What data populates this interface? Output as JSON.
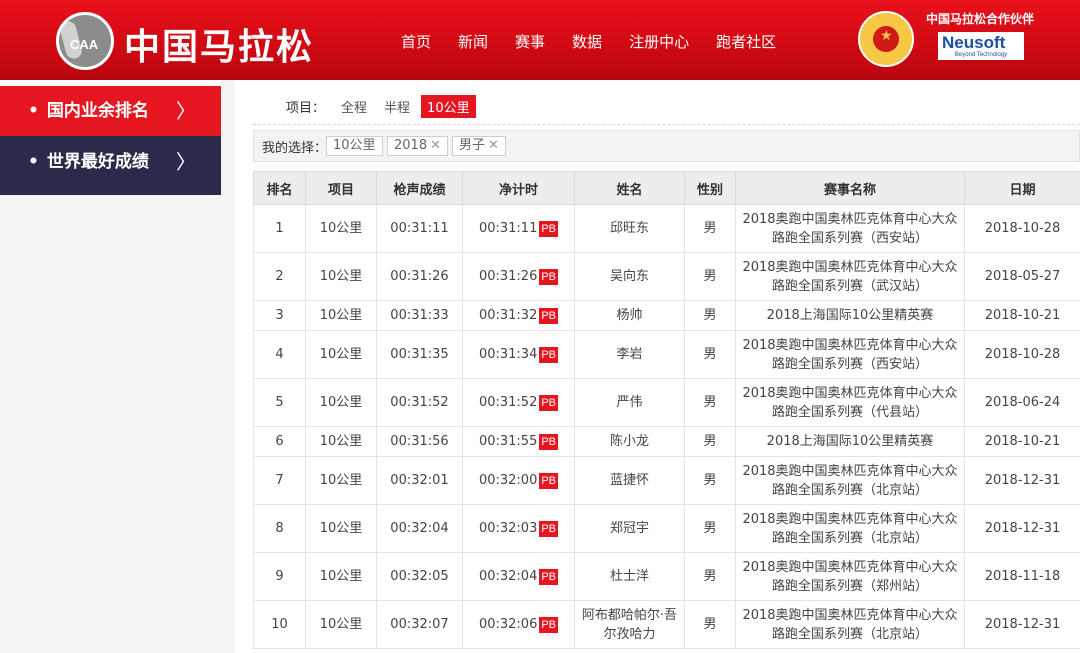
{
  "header": {
    "logo_text": "CAA",
    "brand": "中国马拉松",
    "nav": [
      "首页",
      "新闻",
      "赛事",
      "数据",
      "注册中心",
      "跑者社区"
    ],
    "partner_label": "中国马拉松合作伙伴",
    "partner_name": "Neusoft",
    "partner_tagline": "Beyond Technology"
  },
  "sidebar": {
    "items": [
      {
        "label": "国内业余排名",
        "active": true
      },
      {
        "label": "世界最好成绩",
        "active": false
      }
    ]
  },
  "filters": {
    "label": "项目：",
    "options": [
      "全程",
      "半程",
      "10公里"
    ],
    "selected": "10公里"
  },
  "chosen": {
    "label": "我的选择：",
    "chips": [
      "10公里",
      "2018",
      "男子"
    ]
  },
  "table": {
    "headers": [
      "排名",
      "项目",
      "枪声成绩",
      "净计时",
      "姓名",
      "性别",
      "赛事名称",
      "日期"
    ],
    "pb_label": "PB",
    "rows": [
      {
        "rank": "1",
        "item": "10公里",
        "gun": "00:31:11",
        "net": "00:31:11",
        "name": "邱旺东",
        "sex": "男",
        "event": "2018奥跑中国奥林匹克体育中心大众路跑全国系列赛（西安站）",
        "date": "2018-10-28"
      },
      {
        "rank": "2",
        "item": "10公里",
        "gun": "00:31:26",
        "net": "00:31:26",
        "name": "吴向东",
        "sex": "男",
        "event": "2018奥跑中国奥林匹克体育中心大众路跑全国系列赛（武汉站）",
        "date": "2018-05-27"
      },
      {
        "rank": "3",
        "item": "10公里",
        "gun": "00:31:33",
        "net": "00:31:32",
        "name": "杨帅",
        "sex": "男",
        "event": "2018上海国际10公里精英赛",
        "date": "2018-10-21"
      },
      {
        "rank": "4",
        "item": "10公里",
        "gun": "00:31:35",
        "net": "00:31:34",
        "name": "李岩",
        "sex": "男",
        "event": "2018奥跑中国奥林匹克体育中心大众路跑全国系列赛（西安站）",
        "date": "2018-10-28"
      },
      {
        "rank": "5",
        "item": "10公里",
        "gun": "00:31:52",
        "net": "00:31:52",
        "name": "严伟",
        "sex": "男",
        "event": "2018奥跑中国奥林匹克体育中心大众路跑全国系列赛（代县站）",
        "date": "2018-06-24"
      },
      {
        "rank": "6",
        "item": "10公里",
        "gun": "00:31:56",
        "net": "00:31:55",
        "name": "陈小龙",
        "sex": "男",
        "event": "2018上海国际10公里精英赛",
        "date": "2018-10-21"
      },
      {
        "rank": "7",
        "item": "10公里",
        "gun": "00:32:01",
        "net": "00:32:00",
        "name": "蓝捷怀",
        "sex": "男",
        "event": "2018奥跑中国奥林匹克体育中心大众路跑全国系列赛（北京站）",
        "date": "2018-12-31"
      },
      {
        "rank": "8",
        "item": "10公里",
        "gun": "00:32:04",
        "net": "00:32:03",
        "name": "郑冠宇",
        "sex": "男",
        "event": "2018奥跑中国奥林匹克体育中心大众路跑全国系列赛（北京站）",
        "date": "2018-12-31"
      },
      {
        "rank": "9",
        "item": "10公里",
        "gun": "00:32:05",
        "net": "00:32:04",
        "name": "杜士洋",
        "sex": "男",
        "event": "2018奥跑中国奥林匹克体育中心大众路跑全国系列赛（郑州站）",
        "date": "2018-11-18"
      },
      {
        "rank": "10",
        "item": "10公里",
        "gun": "00:32:07",
        "net": "00:32:06",
        "name": "阿布都哈帕尔·吾尔孜哈力",
        "sex": "男",
        "event": "2018奥跑中国奥林匹克体育中心大众路跑全国系列赛（北京站）",
        "date": "2018-12-31"
      }
    ]
  },
  "colors": {
    "accent": "#e5161f",
    "sidebar_dark": "#2c2a4a",
    "partner_blue": "#1c4fa3"
  }
}
